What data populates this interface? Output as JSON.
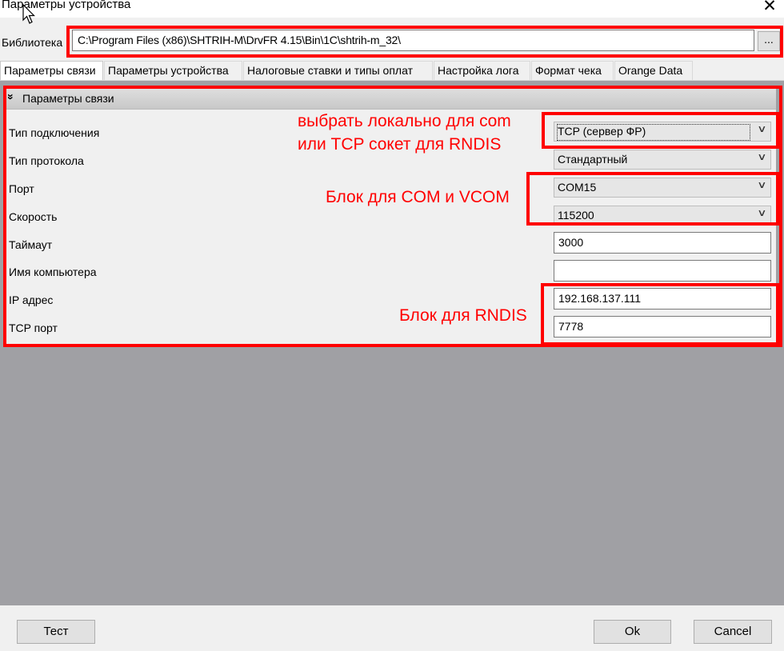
{
  "window": {
    "title": "Параметры устройства",
    "close_glyph": "✕"
  },
  "library": {
    "label": "Библиотека",
    "path": "C:\\Program Files (x86)\\SHTRIH-M\\DrvFR 4.15\\Bin\\1C\\shtrih-m_32\\",
    "browse_label": "..."
  },
  "tabs": [
    {
      "label": "Параметры связи",
      "active": true
    },
    {
      "label": "Параметры устройства"
    },
    {
      "label": "Налоговые ставки и типы оплат"
    },
    {
      "label": "Настройка лога"
    },
    {
      "label": "Формат чека"
    },
    {
      "label": "Orange Data"
    }
  ],
  "section": {
    "title": "Параметры связи",
    "chevron": "»"
  },
  "fields": {
    "connection_type": {
      "label": "Тип подключения",
      "value": "TCP (сервер ФР)"
    },
    "protocol_type": {
      "label": "Тип протокола",
      "value": "Стандартный"
    },
    "port": {
      "label": "Порт",
      "value": "COM15"
    },
    "baud": {
      "label": "Скорость",
      "value": "115200"
    },
    "timeout": {
      "label": "Таймаут",
      "value": "3000"
    },
    "computer_name": {
      "label": "Имя компьютера",
      "value": ""
    },
    "ip": {
      "label": "IP адрес",
      "value": "192.168.137.111"
    },
    "tcp_port": {
      "label": "TCP порт",
      "value": "7778"
    }
  },
  "annotations": {
    "connection_line1": "выбрать локально для com",
    "connection_line2": "или TCP сокет для RNDIS",
    "com_block": "Блок для COM и VCOM",
    "rndis_block": "Блок для RNDIS"
  },
  "buttons": {
    "test": "Тест",
    "ok": "Ok",
    "cancel": "Cancel"
  },
  "dropdown_glyph": "∨",
  "colors": {
    "annotation": "#ff0000",
    "empty_area": "#a0a0a4"
  }
}
